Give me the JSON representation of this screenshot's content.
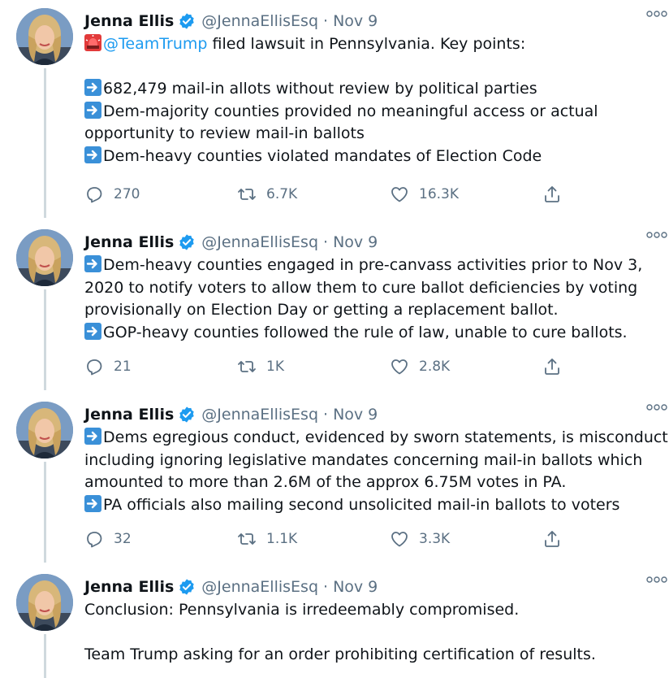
{
  "tweets": [
    {
      "author": {
        "name": "Jenna Ellis",
        "handle": "@JennaEllisEsq",
        "date": "Nov 9"
      },
      "lines": [
        {
          "emoji": "siren",
          "mention": "@TeamTrump",
          "text": " filed lawsuit in Pennsylvania. Key points:"
        },
        {
          "blank": true
        },
        {
          "emoji": "arrow",
          "text": "682,479 mail-in allots without review by political parties"
        },
        {
          "emoji": "arrow",
          "text": "Dem-majority counties provided no meaningful access or actual"
        },
        {
          "text": "opportunity to review mail-in ballots"
        },
        {
          "emoji": "arrow",
          "text": "Dem-heavy counties violated mandates of Election Code"
        }
      ],
      "stats": {
        "replies": "270",
        "retweets": "6.7K",
        "likes": "16.3K"
      }
    },
    {
      "author": {
        "name": "Jenna Ellis",
        "handle": "@JennaEllisEsq",
        "date": "Nov 9"
      },
      "lines": [
        {
          "emoji": "arrow",
          "text": "Dem-heavy counties engaged in pre-canvass activities prior to Nov 3,"
        },
        {
          "text": "2020 to notify voters to allow them to cure ballot deficiencies by voting"
        },
        {
          "text": "provisionally on Election Day or getting a replacement ballot."
        },
        {
          "emoji": "arrow",
          "text": "GOP-heavy counties followed the rule of law, unable to cure ballots."
        }
      ],
      "stats": {
        "replies": "21",
        "retweets": "1K",
        "likes": "2.8K"
      }
    },
    {
      "author": {
        "name": "Jenna Ellis",
        "handle": "@JennaEllisEsq",
        "date": "Nov 9"
      },
      "lines": [
        {
          "emoji": "arrow",
          "text": "Dems egregious conduct, evidenced by sworn statements, is misconduct"
        },
        {
          "text": "including ignoring legislative mandates concerning mail-in ballots which"
        },
        {
          "text": "amounted to more than 2.6M of the approx 6.75M votes in PA."
        },
        {
          "emoji": "arrow",
          "text": "PA officials also mailing second unsolicited mail-in ballots to voters"
        }
      ],
      "stats": {
        "replies": "32",
        "retweets": "1.1K",
        "likes": "3.3K"
      }
    },
    {
      "author": {
        "name": "Jenna Ellis",
        "handle": "@JennaEllisEsq",
        "date": "Nov 9"
      },
      "lines": [
        {
          "text": "Conclusion: Pennsylvania is irredeemably compromised."
        },
        {
          "blank": true
        },
        {
          "text": "Team Trump asking for an order prohibiting certification of results."
        }
      ],
      "stats": null
    }
  ],
  "colors": {
    "accent": "#1d9bf0",
    "muted": "#5b7083",
    "thread_line": "#cfd9de",
    "arrow_emoji": "#3a90d8",
    "siren_emoji": "#e23a3a"
  },
  "icons": {
    "reply": "reply-icon",
    "retweet": "retweet-icon",
    "like": "heart-icon",
    "share": "share-icon",
    "more": "more-dots-icon",
    "verified": "verified-badge-icon"
  }
}
